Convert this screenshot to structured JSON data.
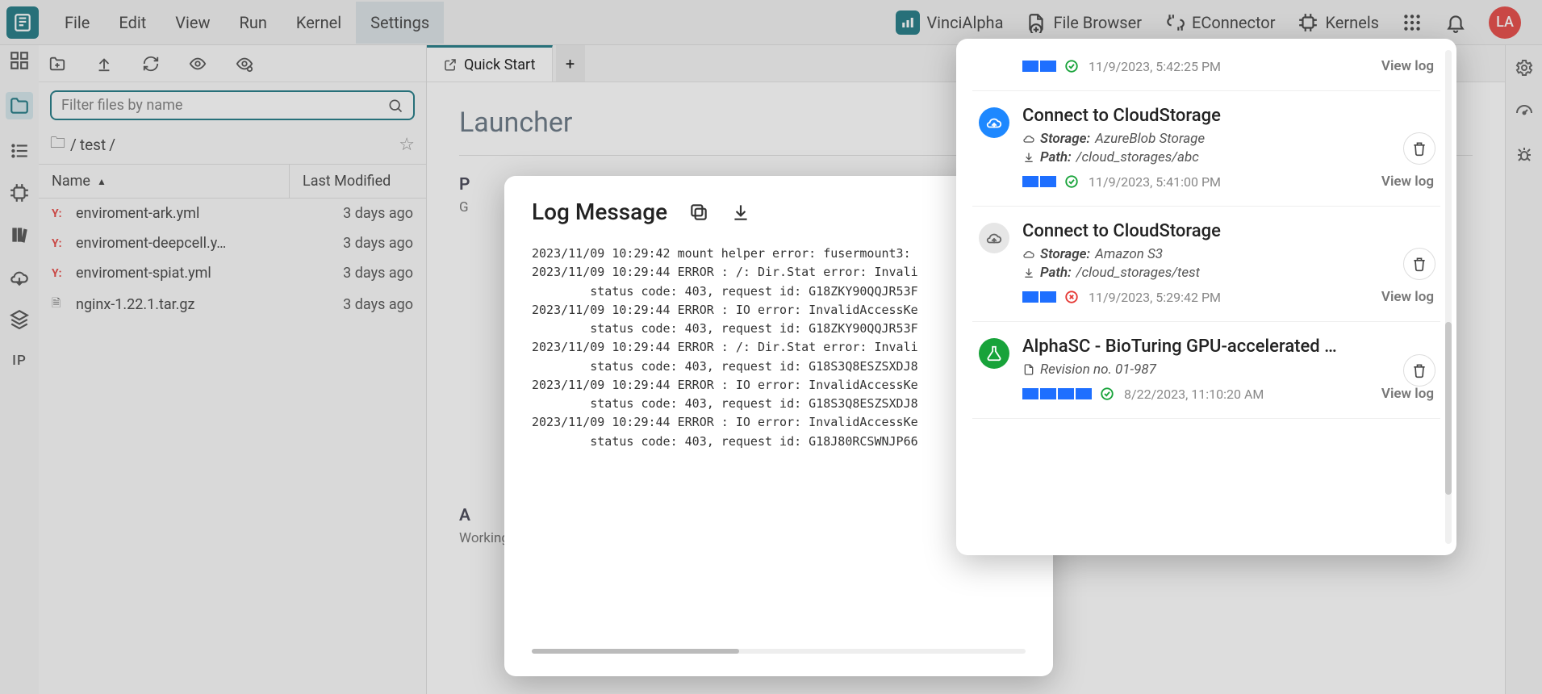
{
  "topbar": {
    "menu": [
      "File",
      "Edit",
      "View",
      "Run",
      "Kernel",
      "Settings"
    ],
    "active_menu_index": 5,
    "right": {
      "vinci": "VinciAlpha",
      "file_browser": "File Browser",
      "econnector": "EConnector",
      "kernels": "Kernels",
      "avatar": "LA"
    }
  },
  "file_panel": {
    "search_placeholder": "Filter files by name",
    "breadcrumb_folder_icon": "🗀",
    "breadcrumb_sep1": "/",
    "breadcrumb_part": "test",
    "breadcrumb_sep2": "/",
    "columns": {
      "name": "Name",
      "modified": "Last Modified"
    },
    "files": [
      {
        "icon": "Y:",
        "icon_class": "yml",
        "name": "enviroment-ark.yml",
        "modified": "3 days ago"
      },
      {
        "icon": "Y:",
        "icon_class": "yml",
        "name": "enviroment-deepcell.y…",
        "modified": "3 days ago"
      },
      {
        "icon": "Y:",
        "icon_class": "yml",
        "name": "enviroment-spiat.yml",
        "modified": "3 days ago"
      },
      {
        "icon": "🗎",
        "icon_class": "doc",
        "name": "nginx-1.22.1.tar.gz",
        "modified": "3 days ago"
      }
    ]
  },
  "left_rail": {
    "ip_label": "IP"
  },
  "content": {
    "tab_label": "Quick Start",
    "launcher_title": "Launcher",
    "section1_title_visible": "P",
    "section1_sub_visible": "G",
    "section2_title_visible": "A",
    "section2_sub": "Working with built-in applications"
  },
  "log_modal": {
    "title": "Log Message",
    "lines": [
      "2023/11/09 10:29:42 mount helper error: fusermount3:",
      "2023/11/09 10:29:44 ERROR : /: Dir.Stat error: Invali",
      "        status code: 403, request id: G18ZKY90QQJR53F",
      "2023/11/09 10:29:44 ERROR : IO error: InvalidAccessKe",
      "        status code: 403, request id: G18ZKY90QQJR53F",
      "2023/11/09 10:29:44 ERROR : /: Dir.Stat error: Invali",
      "        status code: 403, request id: G18S3Q8ESZSXDJ8",
      "2023/11/09 10:29:44 ERROR : IO error: InvalidAccessKe",
      "        status code: 403, request id: G18S3Q8ESZSXDJ8",
      "2023/11/09 10:29:44 ERROR : IO error: InvalidAccessKe",
      "        status code: 403, request id: G18J80RCSWNJP66"
    ]
  },
  "notifications": {
    "items": [
      {
        "title": "",
        "storage_label": "",
        "storage_value": "",
        "path_label": "",
        "path_value": "",
        "segments": 2,
        "status": "ok",
        "time": "11/9/2023, 5:42:25 PM",
        "view": "View log",
        "icon": "none",
        "partial_top": true
      },
      {
        "title": "Connect to CloudStorage",
        "storage_label": "Storage:",
        "storage_value": "AzureBlob Storage",
        "path_label": "Path:",
        "path_value": "/cloud_storages/abc",
        "segments": 2,
        "status": "ok",
        "time": "11/9/2023, 5:41:00 PM",
        "view": "View log",
        "icon": "blue"
      },
      {
        "title": "Connect to CloudStorage",
        "storage_label": "Storage:",
        "storage_value": "Amazon S3",
        "path_label": "Path:",
        "path_value": "/cloud_storages/test",
        "segments": 2,
        "status": "err",
        "time": "11/9/2023, 5:29:42 PM",
        "view": "View log",
        "icon": "gray"
      },
      {
        "title": "AlphaSC - BioTuring GPU-accelerated …",
        "revision_label": "Revision no.",
        "revision_value": "01-987",
        "segments": 4,
        "status": "ok",
        "time": "8/22/2023, 11:10:20 AM",
        "view": "View log",
        "icon": "green"
      }
    ]
  }
}
